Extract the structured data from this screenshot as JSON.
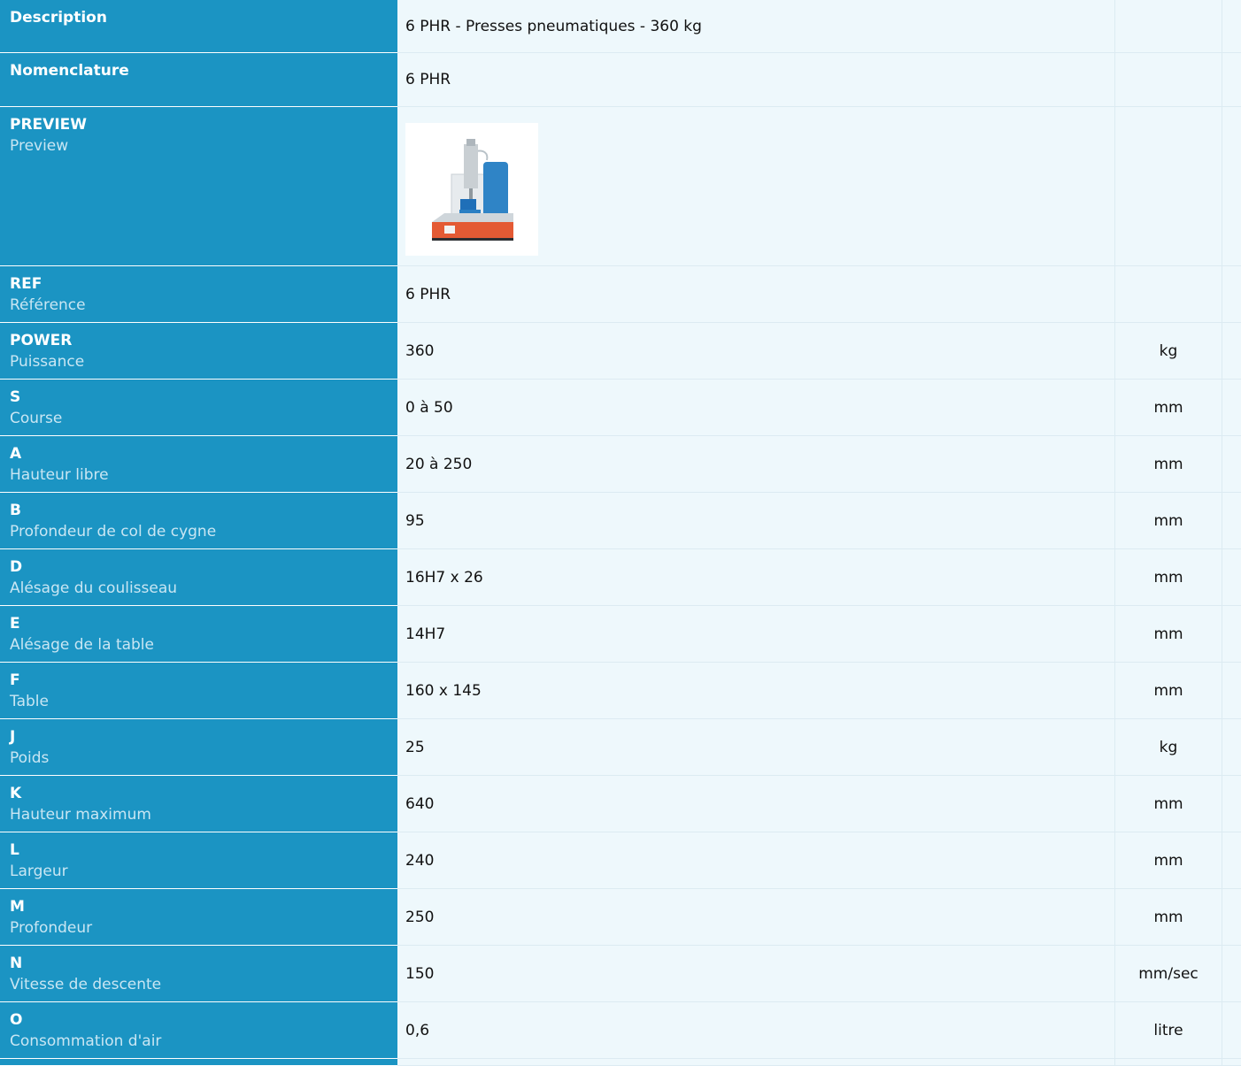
{
  "rows": [
    {
      "main": "Description",
      "sub": "",
      "value": "6 PHR - Presses pneumatiques - 360 kg",
      "unit": ""
    },
    {
      "main": "Nomenclature",
      "sub": "",
      "value": "6 PHR",
      "unit": ""
    },
    {
      "main": "PREVIEW",
      "sub": "Preview",
      "value": "",
      "unit": "",
      "image": "pneumatic-press-photo"
    },
    {
      "main": "REF",
      "sub": "Référence",
      "value": "6 PHR",
      "unit": ""
    },
    {
      "main": "POWER",
      "sub": "Puissance",
      "value": "360",
      "unit": "kg"
    },
    {
      "main": "S",
      "sub": "Course",
      "value": "0 à 50",
      "unit": "mm"
    },
    {
      "main": "A",
      "sub": "Hauteur libre",
      "value": "20 à 250",
      "unit": "mm"
    },
    {
      "main": "B",
      "sub": "Profondeur de col de cygne",
      "value": "95",
      "unit": "mm"
    },
    {
      "main": "D",
      "sub": "Alésage du coulisseau",
      "value": "16H7 x 26",
      "unit": "mm"
    },
    {
      "main": "E",
      "sub": "Alésage de la table",
      "value": "14H7",
      "unit": "mm"
    },
    {
      "main": "F",
      "sub": "Table",
      "value": "160 x 145",
      "unit": "mm"
    },
    {
      "main": "J",
      "sub": "Poids",
      "value": "25",
      "unit": "kg"
    },
    {
      "main": "K",
      "sub": "Hauteur maximum",
      "value": "640",
      "unit": "mm"
    },
    {
      "main": "L",
      "sub": "Largeur",
      "value": "240",
      "unit": "mm"
    },
    {
      "main": "M",
      "sub": "Profondeur",
      "value": "250",
      "unit": "mm"
    },
    {
      "main": "N",
      "sub": "Vitesse de descente",
      "value": "150",
      "unit": "mm/sec"
    },
    {
      "main": "O",
      "sub": "Consommation d'air",
      "value": "0,6",
      "unit": "litre"
    }
  ],
  "colors": {
    "label_background": "#1b94c3",
    "label_text": "#ffffff",
    "label_subtext": "#c9e6f3",
    "value_background": "#eef8fc"
  }
}
